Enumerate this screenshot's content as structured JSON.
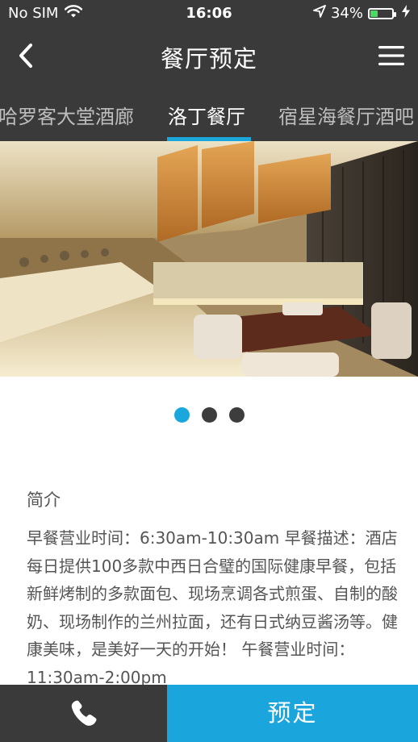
{
  "status_bar": {
    "carrier": "No SIM",
    "time": "16:06",
    "battery_percent": "34%",
    "battery_level": 0.34,
    "icons": [
      "wifi-icon",
      "location-arrow-icon",
      "battery-icon",
      "charging-bolt-icon"
    ]
  },
  "nav": {
    "title": "餐厅预定",
    "back_icon": "chevron-left-icon",
    "menu_icon": "hamburger-menu-icon"
  },
  "tabs": [
    {
      "label": "哈罗客大堂酒廊",
      "active": false
    },
    {
      "label": "洛丁餐厅",
      "active": true
    },
    {
      "label": "宿星海餐厅酒吧",
      "active": false
    }
  ],
  "carousel": {
    "slide_count": 3,
    "active_index": 0
  },
  "intro": {
    "heading": "简介",
    "body": "早餐营业时间：6:30am-10:30am 早餐描述：酒店每日提供100多款中西日合璧的国际健康早餐，包括新鲜烤制的多款面包、现场烹调各式煎蛋、自制的酸奶、现场制作的兰州拉面，还有日式纳豆酱汤等。健康美味，是美好一天的开始！ 午餐营业时间：11:30am-2:00pm"
  },
  "bottom_bar": {
    "call_icon": "phone-icon",
    "book_label": "预定"
  },
  "colors": {
    "header_bg": "#3a3a3a",
    "accent": "#19a7dc",
    "text": "#555555"
  }
}
